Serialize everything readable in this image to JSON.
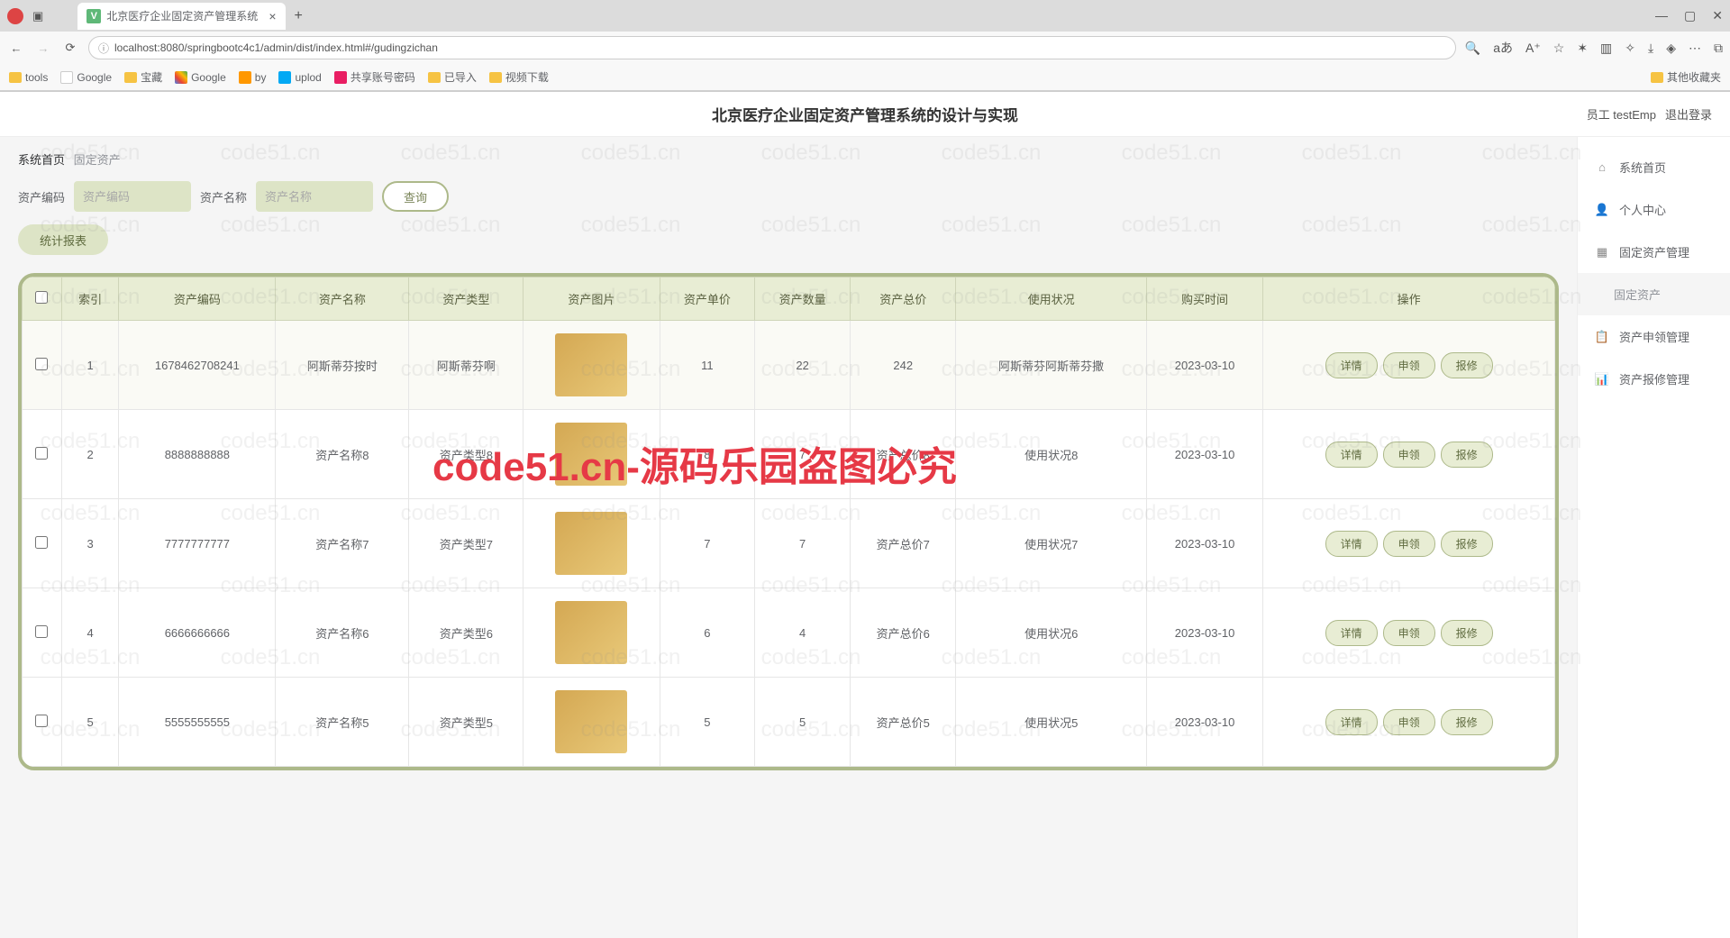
{
  "browser": {
    "tab_title": "北京医疗企业固定资产管理系统",
    "url": "localhost:8080/springbootc4c1/admin/dist/index.html#/gudingzichan",
    "bookmarks": [
      "tools",
      "Google",
      "宝藏",
      "Google",
      "by",
      "uplod",
      "共享账号密码",
      "已导入",
      "视频下载"
    ],
    "other_bookmarks": "其他收藏夹"
  },
  "header": {
    "title": "北京医疗企业固定资产管理系统的设计与实现",
    "user_label": "员工 testEmp",
    "logout": "退出登录"
  },
  "breadcrumb": {
    "home": "系统首页",
    "current": "固定资产"
  },
  "filters": {
    "code_label": "资产编码",
    "code_placeholder": "资产编码",
    "name_label": "资产名称",
    "name_placeholder": "资产名称",
    "query": "查询",
    "stats": "统计报表"
  },
  "nav": {
    "home": "系统首页",
    "personal": "个人中心",
    "asset_mgmt": "固定资产管理",
    "asset": "固定资产",
    "claim": "资产申领管理",
    "repair": "资产报修管理"
  },
  "columns": [
    "",
    "索引",
    "资产编码",
    "资产名称",
    "资产类型",
    "资产图片",
    "资产单价",
    "资产数量",
    "资产总价",
    "使用状况",
    "购买时间",
    "操作"
  ],
  "actions": {
    "detail": "详情",
    "claim": "申领",
    "repair": "报修"
  },
  "rows": [
    {
      "idx": "1",
      "code": "1678462708241",
      "name": "阿斯蒂芬按时",
      "type": "阿斯蒂芬啊",
      "price": "11",
      "qty": "22",
      "total": "242",
      "status": "阿斯蒂芬阿斯蒂芬撒",
      "date": "2023-03-10"
    },
    {
      "idx": "2",
      "code": "8888888888",
      "name": "资产名称8",
      "type": "资产类型8",
      "price": "8",
      "qty": "7",
      "total": "资产总价8",
      "status": "使用状况8",
      "date": "2023-03-10"
    },
    {
      "idx": "3",
      "code": "7777777777",
      "name": "资产名称7",
      "type": "资产类型7",
      "price": "7",
      "qty": "7",
      "total": "资产总价7",
      "status": "使用状况7",
      "date": "2023-03-10"
    },
    {
      "idx": "4",
      "code": "6666666666",
      "name": "资产名称6",
      "type": "资产类型6",
      "price": "6",
      "qty": "4",
      "total": "资产总价6",
      "status": "使用状况6",
      "date": "2023-03-10"
    },
    {
      "idx": "5",
      "code": "5555555555",
      "name": "资产名称5",
      "type": "资产类型5",
      "price": "5",
      "qty": "5",
      "total": "资产总价5",
      "status": "使用状况5",
      "date": "2023-03-10"
    }
  ],
  "watermark": "code51.cn-源码乐园盗图必究",
  "wm_tile": "code51.cn"
}
